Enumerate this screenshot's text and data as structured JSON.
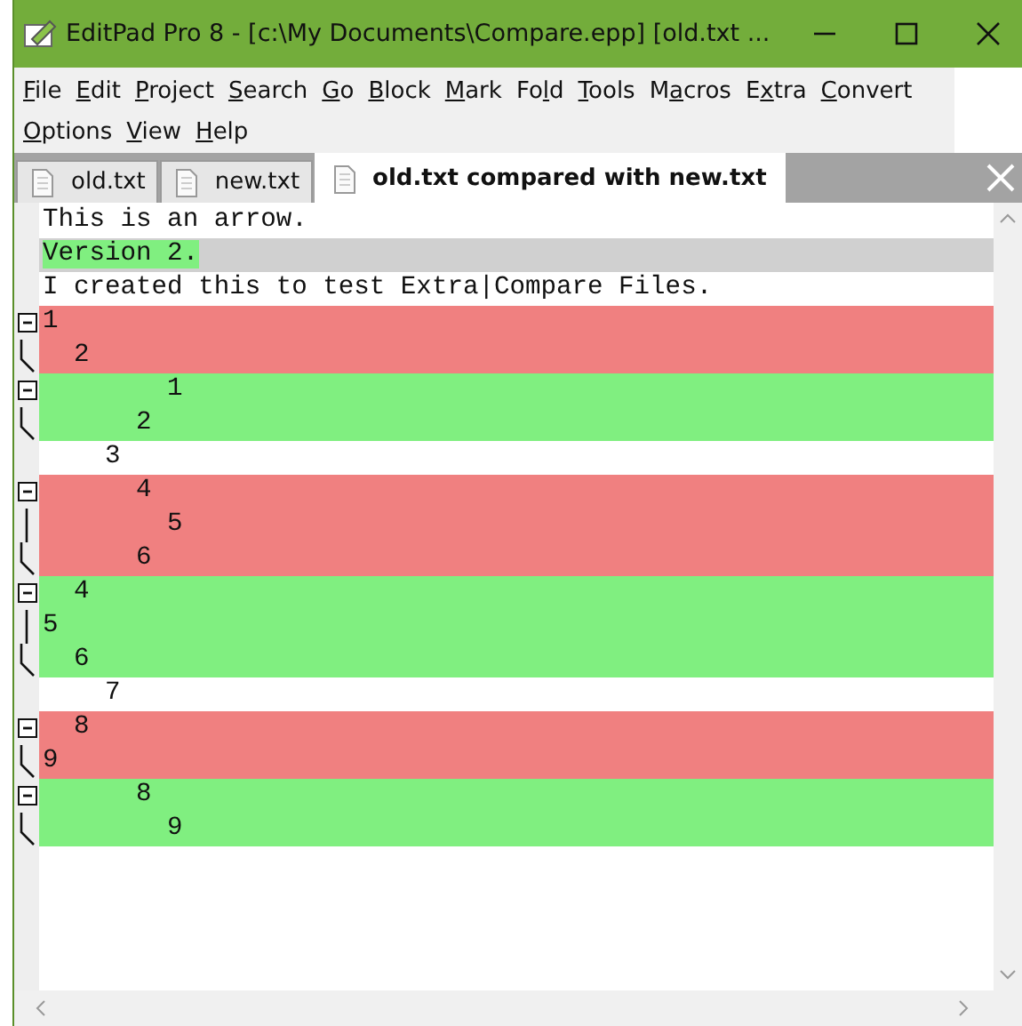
{
  "window": {
    "title": "EditPad Pro 8 - [c:\\My Documents\\Compare.epp] [old.txt ..."
  },
  "menu": [
    {
      "key": "F",
      "post": "ile"
    },
    {
      "key": "E",
      "post": "dit"
    },
    {
      "key": "P",
      "post": "roject"
    },
    {
      "key": "S",
      "post": "earch"
    },
    {
      "key": "G",
      "post": "o"
    },
    {
      "key": "B",
      "post": "lock"
    },
    {
      "key": "M",
      "post": "ark"
    },
    {
      "pre": "Fo",
      "key": "l",
      "post": "d"
    },
    {
      "key": "T",
      "post": "ools"
    },
    {
      "pre": "M",
      "key": "a",
      "post": "cros"
    },
    {
      "pre": "E",
      "key": "x",
      "post": "tra"
    },
    {
      "key": "C",
      "post": "onvert"
    },
    {
      "key": "O",
      "post": "ptions"
    },
    {
      "key": "V",
      "post": "iew"
    },
    {
      "key": "H",
      "post": "elp"
    }
  ],
  "tabs": [
    {
      "label": "old.txt",
      "selected": false
    },
    {
      "label": "new.txt",
      "selected": false
    },
    {
      "label": "old.txt compared with new.txt",
      "selected": true
    }
  ],
  "blocks": [
    {
      "kind": "same",
      "lines": [
        {
          "text": "This is an arrow.",
          "current": false,
          "highlighted": false
        },
        {
          "text": "Version 2.",
          "current": true,
          "highlighted": true
        },
        {
          "text": "I created this to test Extra|Compare Files.",
          "current": false,
          "highlighted": false
        }
      ]
    },
    {
      "kind": "deleted",
      "expanded": true,
      "lines": [
        {
          "text": "1"
        },
        {
          "text": "  2"
        }
      ]
    },
    {
      "kind": "inserted",
      "expanded": true,
      "lines": [
        {
          "text": "        1"
        },
        {
          "text": "      2"
        }
      ]
    },
    {
      "kind": "same",
      "lines": [
        {
          "text": "    3",
          "current": false,
          "highlighted": false
        }
      ]
    },
    {
      "kind": "deleted",
      "expanded": true,
      "lines": [
        {
          "text": "      4"
        },
        {
          "text": "        5"
        },
        {
          "text": "      6"
        }
      ]
    },
    {
      "kind": "inserted",
      "expanded": true,
      "lines": [
        {
          "text": "  4"
        },
        {
          "text": "5"
        },
        {
          "text": "  6"
        }
      ]
    },
    {
      "kind": "same",
      "lines": [
        {
          "text": "    7",
          "current": false,
          "highlighted": false
        }
      ]
    },
    {
      "kind": "deleted",
      "expanded": true,
      "lines": [
        {
          "text": "  8"
        },
        {
          "text": "9"
        }
      ]
    },
    {
      "kind": "inserted",
      "expanded": true,
      "lines": [
        {
          "text": "      8"
        },
        {
          "text": "        9"
        }
      ]
    }
  ]
}
